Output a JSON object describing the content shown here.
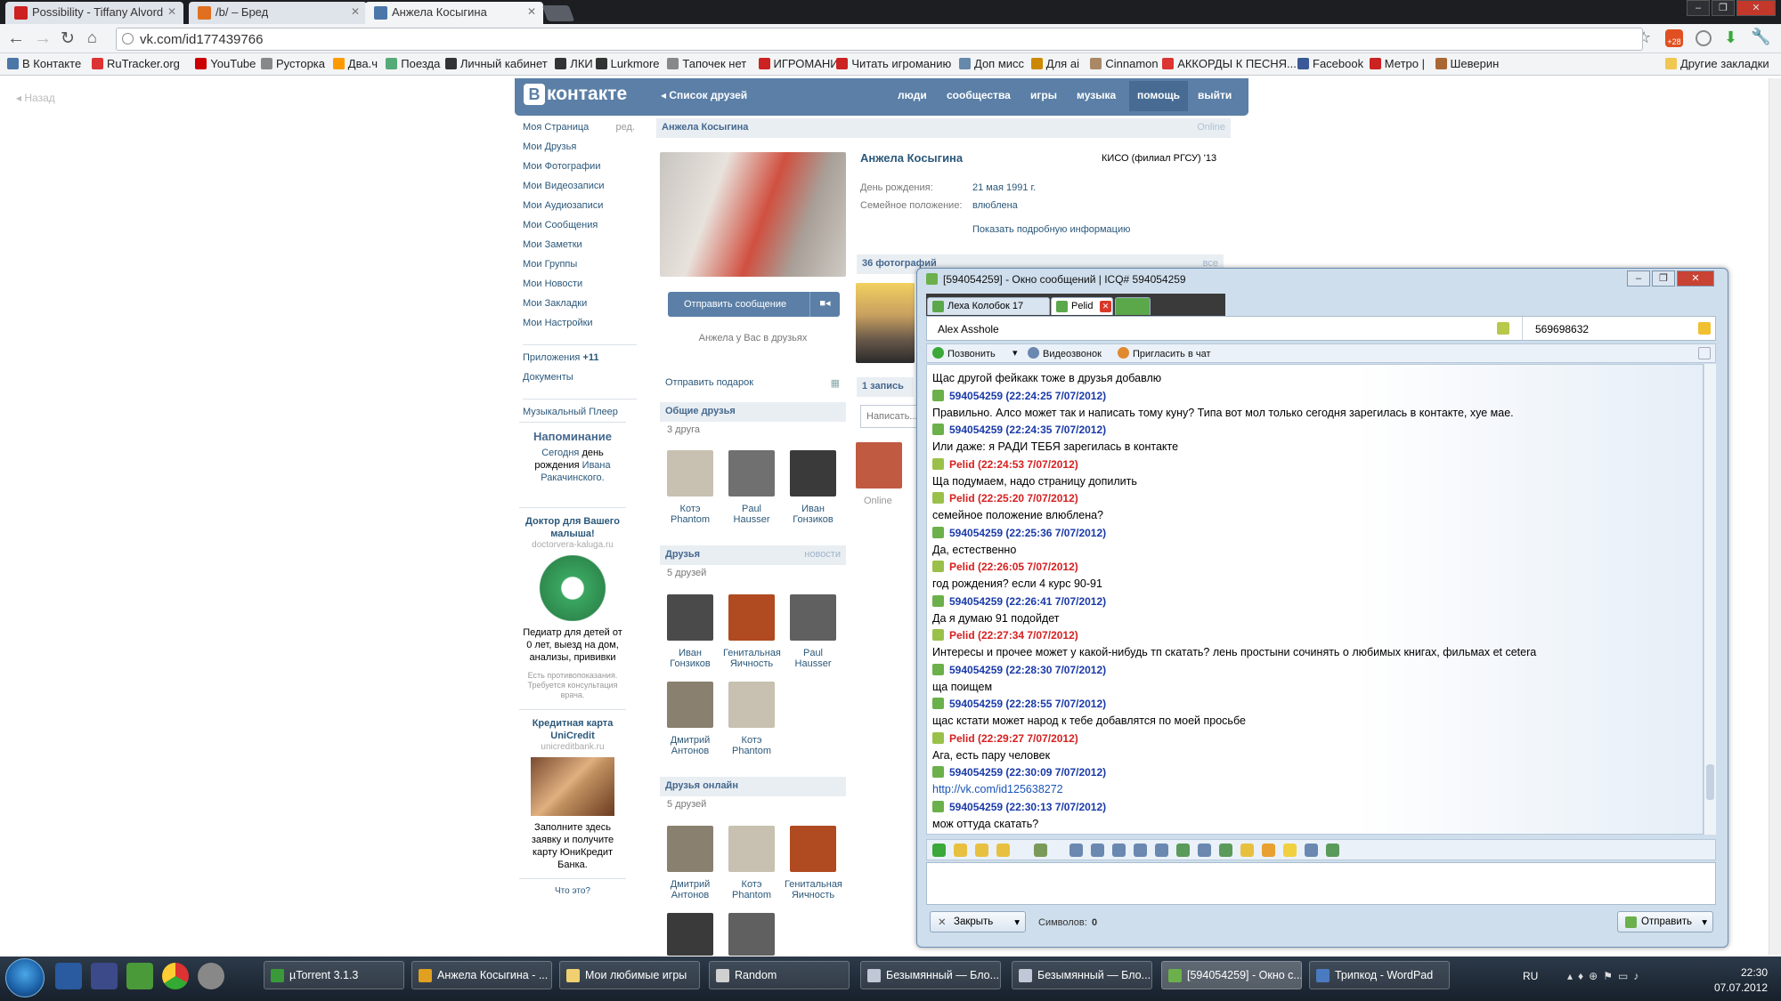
{
  "browser": {
    "tabs": [
      {
        "label": "Possibility - Tiffany Alvord",
        "color": "#cc2222"
      },
      {
        "label": "/b/ – Бред",
        "color": "#e07020"
      },
      {
        "label": "Анжела Косыгина",
        "color": "#4a76a8"
      }
    ],
    "url": "vk.com/id177439766",
    "ext_badge": "+28",
    "bookmarks": [
      "В Контакте",
      "RuTracker.org",
      "YouTube",
      "Русторка",
      "Два.ч",
      "Поезда",
      "Личный кабинет",
      "ЛКИ",
      "Lurkmore",
      "Тапочек нет",
      "ИГРОМАНИЯ",
      "Читать игроманию",
      "Доп мисс",
      "Для ai",
      "Cinnamon",
      "АККОРДЫ К ПЕСНЯ...",
      "Facebook",
      "Метро |",
      "Шеверин"
    ],
    "other_bookmarks": "Другие закладки"
  },
  "vk": {
    "back": "Назад",
    "logo": "контакте",
    "logo_letter": "В",
    "friends_list": "Список друзей",
    "nav": [
      "люди",
      "сообщества",
      "игры",
      "музыка",
      "помощь",
      "выйти"
    ],
    "menu": [
      "Моя Страница",
      "Мои Друзья",
      "Мои Фотографии",
      "Мои Видеозаписи",
      "Мои Аудиозаписи",
      "Мои Сообщения",
      "Мои Заметки",
      "Мои Группы",
      "Мои Новости",
      "Мои Закладки",
      "Мои Настройки"
    ],
    "menu_edit": "ред.",
    "apps": "Приложения",
    "apps_count": "+11",
    "docs": "Документы",
    "player": "Музыкальный Плеер",
    "reminder_title": "Напоминание",
    "reminder_text1": "Сегодня",
    "reminder_text2": "день рождения",
    "reminder_name": "Ивана Ракачинского.",
    "ad1_title": "Доктор для Вашего малыша!",
    "ad1_domain": "doctorvera-kaluga.ru",
    "ad1_text": "Педиатр для детей от 0 лет, выезд на дом, анализы, прививки",
    "ad1_note": "Есть противопоказания. Требуется консультация врача.",
    "ad2_title": "Кредитная карта UniCredit",
    "ad2_domain": "unicreditbank.ru",
    "ad2_text": "Заполните здесь заявку и получите карту ЮниКредит Банка.",
    "ad_what": "Что это?",
    "profile_header": "Анжела Косыгина",
    "online": "Online",
    "name": "Анжела Косыгина",
    "school": "КИСО (филиал РГСУ) '13",
    "bday_label": "День рождения:",
    "bday": "21 мая 1991 г.",
    "status_label": "Семейное положение:",
    "status": "влюблена",
    "more_info": "Показать подробную информацию",
    "photos_header": "36 фотографий",
    "photos_all": "все",
    "send_msg": "Отправить сообщение",
    "in_friends": "Анжела у Вас в друзьях",
    "gift": "Отправить подарок",
    "common_friends": "Общие друзья",
    "common_count": "3 друга",
    "common": [
      {
        "name": "Котэ Phantom"
      },
      {
        "name": "Paul Hausser"
      },
      {
        "name": "Иван Гонзиков"
      }
    ],
    "friends": "Друзья",
    "friends_news": "новости",
    "friends_count": "5 друзей",
    "friends_list_items": [
      {
        "name": "Иван Гонзиков"
      },
      {
        "name": "Генитальная Яичность"
      },
      {
        "name": "Paul Hausser"
      },
      {
        "name": "Дмитрий Антонов"
      },
      {
        "name": "Котэ Phantom"
      }
    ],
    "online_friends": "Друзья онлайн",
    "online_count": "5 друзей",
    "online_items": [
      {
        "name": "Дмитрий Антонов"
      },
      {
        "name": "Котэ Phantom"
      },
      {
        "name": "Генитальная Яичность"
      }
    ],
    "wall_header": "1 запись",
    "wall_placeholder": "Написать...",
    "wall_online": "Online"
  },
  "icq": {
    "title": "[594054259] - Окно сообщений | ICQ# 594054259",
    "tabs": [
      "Леха Колобок 17",
      "Pelid",
      ""
    ],
    "contact": "Alex Asshole",
    "contact_uin": "569698632",
    "call": "Позвонить",
    "video": "Видеозвонок",
    "invite": "Пригласить в чат",
    "messages": [
      {
        "kind": "text",
        "text": "Щас другой фейкакк тоже в друзья добавлю"
      },
      {
        "kind": "head",
        "who": "me",
        "text": "594054259 (22:24:25 7/07/2012)"
      },
      {
        "kind": "text",
        "text": "Правильно. Алсо может так  и написать тому куну? Типа вот мол только сегодня зарегилась в контакте, хуе мае."
      },
      {
        "kind": "head",
        "who": "me",
        "text": "594054259 (22:24:35 7/07/2012)"
      },
      {
        "kind": "text",
        "text": "Или даже: я РАДИ ТЕБЯ зарегилась в контакте"
      },
      {
        "kind": "head",
        "who": "them",
        "text": "Pelid (22:24:53 7/07/2012)"
      },
      {
        "kind": "text",
        "text": "Ща подумаем, надо страницу допилить"
      },
      {
        "kind": "head",
        "who": "them",
        "text": "Pelid (22:25:20 7/07/2012)"
      },
      {
        "kind": "text",
        "text": "семейное положение влюблена?"
      },
      {
        "kind": "head",
        "who": "me",
        "text": "594054259 (22:25:36 7/07/2012)"
      },
      {
        "kind": "text",
        "text": "Да, естественно"
      },
      {
        "kind": "head",
        "who": "them",
        "text": "Pelid (22:26:05 7/07/2012)"
      },
      {
        "kind": "text",
        "text": "год рождения? если 4 курс 90-91"
      },
      {
        "kind": "head",
        "who": "me",
        "text": "594054259 (22:26:41 7/07/2012)"
      },
      {
        "kind": "text",
        "text": "Да я думаю 91 подойдет"
      },
      {
        "kind": "head",
        "who": "them",
        "text": "Pelid (22:27:34 7/07/2012)"
      },
      {
        "kind": "text",
        "text": "Интересы и прочее может у какой-нибудь тп скатать? лень простыни сочинять о любимых книгах, фильмах et cetera"
      },
      {
        "kind": "head",
        "who": "me",
        "text": "594054259 (22:28:30 7/07/2012)"
      },
      {
        "kind": "text",
        "text": "ща поищем"
      },
      {
        "kind": "head",
        "who": "me",
        "text": "594054259 (22:28:55 7/07/2012)"
      },
      {
        "kind": "text",
        "text": "щас кстати может народ к тебе добавлятся по моей просьбе"
      },
      {
        "kind": "head",
        "who": "them",
        "text": "Pelid (22:29:27 7/07/2012)"
      },
      {
        "kind": "text",
        "text": "Ага, есть пару человек"
      },
      {
        "kind": "head",
        "who": "me",
        "text": "594054259 (22:30:09 7/07/2012)"
      },
      {
        "kind": "link",
        "text": "http://vk.com/id125638272"
      },
      {
        "kind": "head",
        "who": "me",
        "text": "594054259 (22:30:13 7/07/2012)"
      },
      {
        "kind": "text",
        "text": "мож оттуда скатать?"
      }
    ],
    "close": "Закрыть",
    "chars_label": "Символов:",
    "chars": "0",
    "send": "Отправить"
  },
  "taskbar": {
    "items": [
      {
        "label": "µTorrent 3.1.3",
        "color": "#3a9a3a"
      },
      {
        "label": "Анжела Косыгина - ...",
        "color": "#e0a020"
      },
      {
        "label": "Мои любимые игры",
        "color": "#f0d070"
      },
      {
        "label": "Random",
        "color": "#d0d0d0"
      },
      {
        "label": "Безымянный — Бло...",
        "color": "#c0c8d8"
      },
      {
        "label": "Безымянный — Бло...",
        "color": "#c0c8d8"
      },
      {
        "label": "[594054259] - Окно с...",
        "color": "#6bb04b"
      },
      {
        "label": "Трипкод - WordPad",
        "color": "#4a7ac0"
      }
    ],
    "lang": "RU",
    "time": "22:30",
    "date": "07.07.2012"
  }
}
